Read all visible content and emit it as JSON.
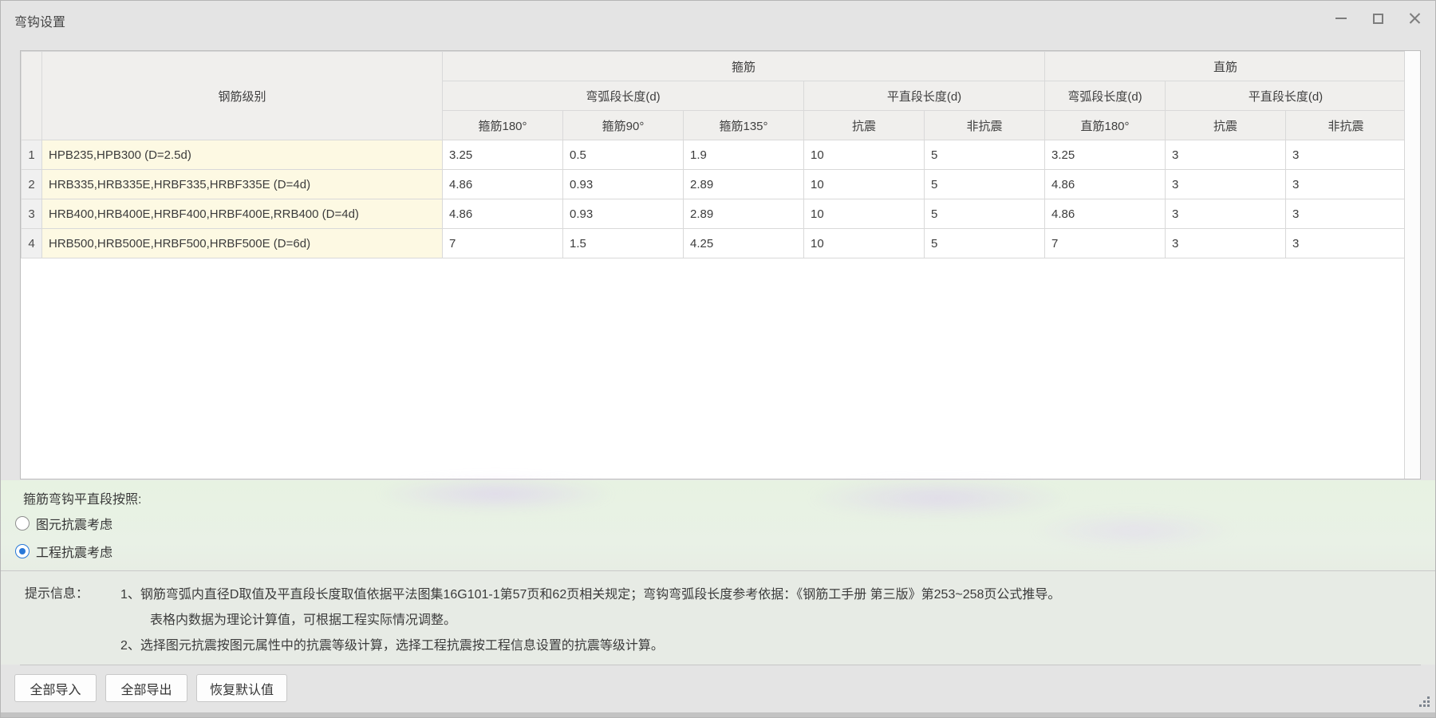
{
  "window": {
    "title": "弯钩设置",
    "icons": {
      "minimize": "minimize-icon",
      "maximize": "maximize-icon",
      "close": "close-icon",
      "resize_grip": "resize-grip-icon"
    }
  },
  "table": {
    "header": {
      "col_rebar_level": "钢筋级别",
      "group_stirrup": "箍筋",
      "group_straight": "直筋",
      "stirrup_arc": "弯弧段长度(d)",
      "stirrup_straight": "平直段长度(d)",
      "straight_arc": "弯弧段长度(d)",
      "straight_straight": "平直段长度(d)",
      "leaf": [
        "箍筋180°",
        "箍筋90°",
        "箍筋135°",
        "抗震",
        "非抗震",
        "直筋180°",
        "抗震",
        "非抗震"
      ]
    },
    "rows": [
      {
        "num": "1",
        "level": "HPB235,HPB300 (D=2.5d)",
        "values": [
          "3.25",
          "0.5",
          "1.9",
          "10",
          "5",
          "3.25",
          "3",
          "3"
        ]
      },
      {
        "num": "2",
        "level": "HRB335,HRB335E,HRBF335,HRBF335E (D=4d)",
        "values": [
          "4.86",
          "0.93",
          "2.89",
          "10",
          "5",
          "4.86",
          "3",
          "3"
        ]
      },
      {
        "num": "3",
        "level": "HRB400,HRB400E,HRBF400,HRBF400E,RRB400 (D=4d)",
        "values": [
          "4.86",
          "0.93",
          "2.89",
          "10",
          "5",
          "4.86",
          "3",
          "3"
        ]
      },
      {
        "num": "4",
        "level": "HRB500,HRB500E,HRBF500,HRBF500E (D=6d)",
        "values": [
          "7",
          "1.5",
          "4.25",
          "10",
          "5",
          "7",
          "3",
          "3"
        ]
      }
    ]
  },
  "options": {
    "label": "箍筋弯钩平直段按照:",
    "items": [
      {
        "label": "图元抗震考虑",
        "selected": false
      },
      {
        "label": "工程抗震考虑",
        "selected": true
      }
    ]
  },
  "hint": {
    "label": "提示信息：",
    "lines": [
      "1、钢筋弯弧内直径D取值及平直段长度取值依据平法图集16G101-1第57页和62页相关规定；弯钩弯弧段长度参考依据：《钢筋工手册 第三版》第253~258页公式推导。",
      "表格内数据为理论计算值，可根据工程实际情况调整。",
      "2、选择图元抗震按图元属性中的抗震等级计算，选择工程抗震按工程信息设置的抗震等级计算。"
    ]
  },
  "footer": {
    "buttons": [
      "全部导入",
      "全部导出",
      "恢复默认值"
    ]
  },
  "colors": {
    "accent": "#2878d8",
    "row_highlight": "#fdf9e3",
    "header_bg": "#f0efed"
  }
}
